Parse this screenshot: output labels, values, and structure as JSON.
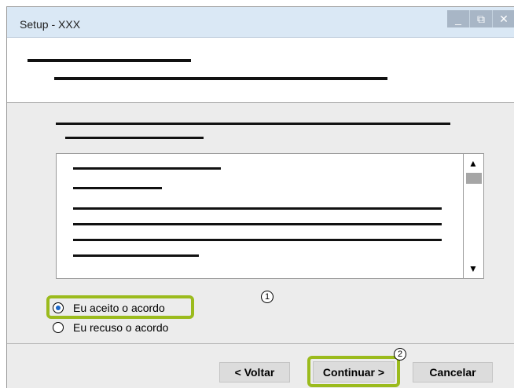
{
  "window": {
    "title": "Setup - XXX",
    "controls": {
      "minimize": "_",
      "restore": "⧉",
      "close": "✕"
    }
  },
  "scrollbar": {
    "up_arrow": "▲",
    "down_arrow": "▼"
  },
  "license_options": [
    {
      "label": "Eu aceito o acordo",
      "selected": true
    },
    {
      "label": "Eu recuso o acordo",
      "selected": false
    }
  ],
  "callouts": {
    "first": "1",
    "second": "2"
  },
  "footer": {
    "back_label": "< Voltar",
    "next_label": "Continuar >",
    "cancel_label": "Cancelar"
  },
  "colors": {
    "callout": "#9bbb1d",
    "titlebar": "#dae8f5",
    "radio_selected": "#1a66c9"
  }
}
